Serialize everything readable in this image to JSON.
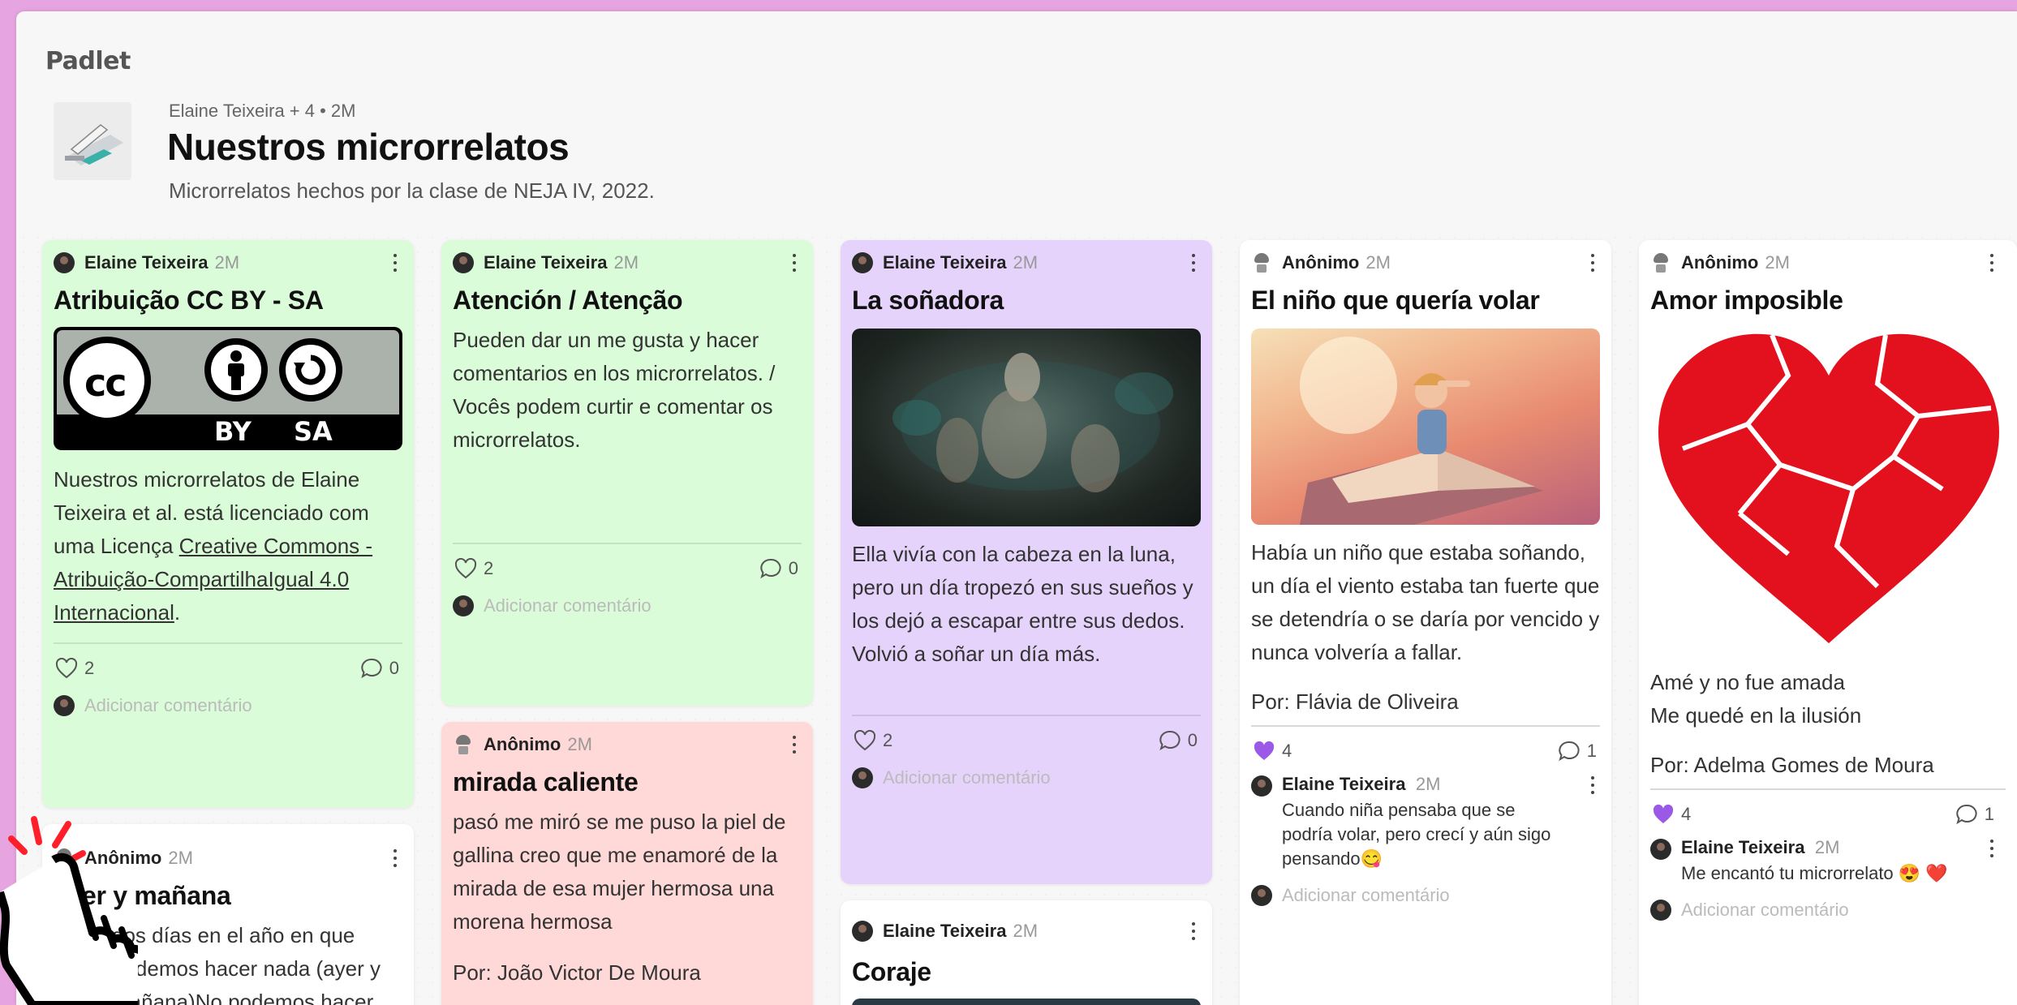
{
  "brand": "Padlet",
  "board": {
    "meta": "Elaine Teixeira + 4 • 2M",
    "title": "Nuestros microrrelatos",
    "description": "Microrrelatos hechos por la clase de NEJA IV, 2022."
  },
  "add_comment_placeholder": "Adicionar comentário",
  "colors": {
    "green": "#dafcd8",
    "pink": "#ffd8d8",
    "purple": "#e6d3fc",
    "white": "#ffffff",
    "like_active": "#9b59e8"
  },
  "cards": {
    "c1": {
      "author": "Elaine Teixeira",
      "time": "2M",
      "title": "Atribuição CC BY - SA",
      "badge": {
        "by": "BY",
        "sa": "SA"
      },
      "body_prefix": " Nuestros microrrelatos de Elaine Teixeira et al. está licenciado com uma Licença ",
      "body_link": "Creative Commons - Atribuição-CompartilhaIgual 4.0 Internacional",
      "body_suffix": ".",
      "likes": "2",
      "comments": "0"
    },
    "c2": {
      "author": "Elaine Teixeira",
      "time": "2M",
      "title": "Atención / Atenção",
      "body_1": "Pueden dar un me gusta y hacer comentarios en los microrrelatos. /",
      "body_2": "Vocês podem curtir e comentar os microrrelatos.",
      "likes": "2",
      "comments": "0"
    },
    "c3": {
      "author": "Elaine Teixeira",
      "time": "2M",
      "title": "La soñadora",
      "body": "Ella vivía con la cabeza en la luna, pero un día  tropezó en sus sueños y los dejó a escapar entre sus dedos. Volvió a soñar un día más.",
      "likes": "2",
      "comments": "0"
    },
    "c4": {
      "author": "Anônimo",
      "time": "2M",
      "title": "El niño que quería volar",
      "body": "Había un niño que estaba soñando, un día el viento estaba tan fuerte que se detendría o se daría por vencido y nunca volvería a fallar.",
      "byline": "Por: Flávia de Oliveira",
      "likes": "4",
      "comments": "1",
      "comment": {
        "author": "Elaine Teixeira",
        "time": "2M",
        "text": "Cuando niña pensaba que se podría volar, pero crecí y aún sigo pensando😋"
      }
    },
    "c5": {
      "author": "Anônimo",
      "time": "2M",
      "title": "Amor imposible",
      "body_1": "Amé y no fue amada",
      "body_2": "Me quedé en la ilusión",
      "byline": "Por: Adelma Gomes de Moura",
      "likes": "4",
      "comments": "1",
      "comment": {
        "author": "Elaine Teixeira",
        "time": "2M",
        "text": "Me encantó tu microrrelato 😍 ❤️"
      }
    },
    "c6": {
      "author": "Anônimo",
      "time": "2M",
      "title": "mirada caliente",
      "body": "pasó me miró se me puso la piel de gallina creo que me enamoré de la mirada de esa mujer hermosa una morena hermosa",
      "byline": "Por: João Victor De Moura"
    },
    "c7": {
      "author": "Anônimo",
      "time": "2M",
      "title": "ayer y mañana",
      "body": "dos días en el año en que podemos hacer nada (ayer y mañana)No podemos hacer"
    },
    "c8": {
      "author": "Elaine Teixeira",
      "time": "2M",
      "title": "Coraje"
    }
  }
}
